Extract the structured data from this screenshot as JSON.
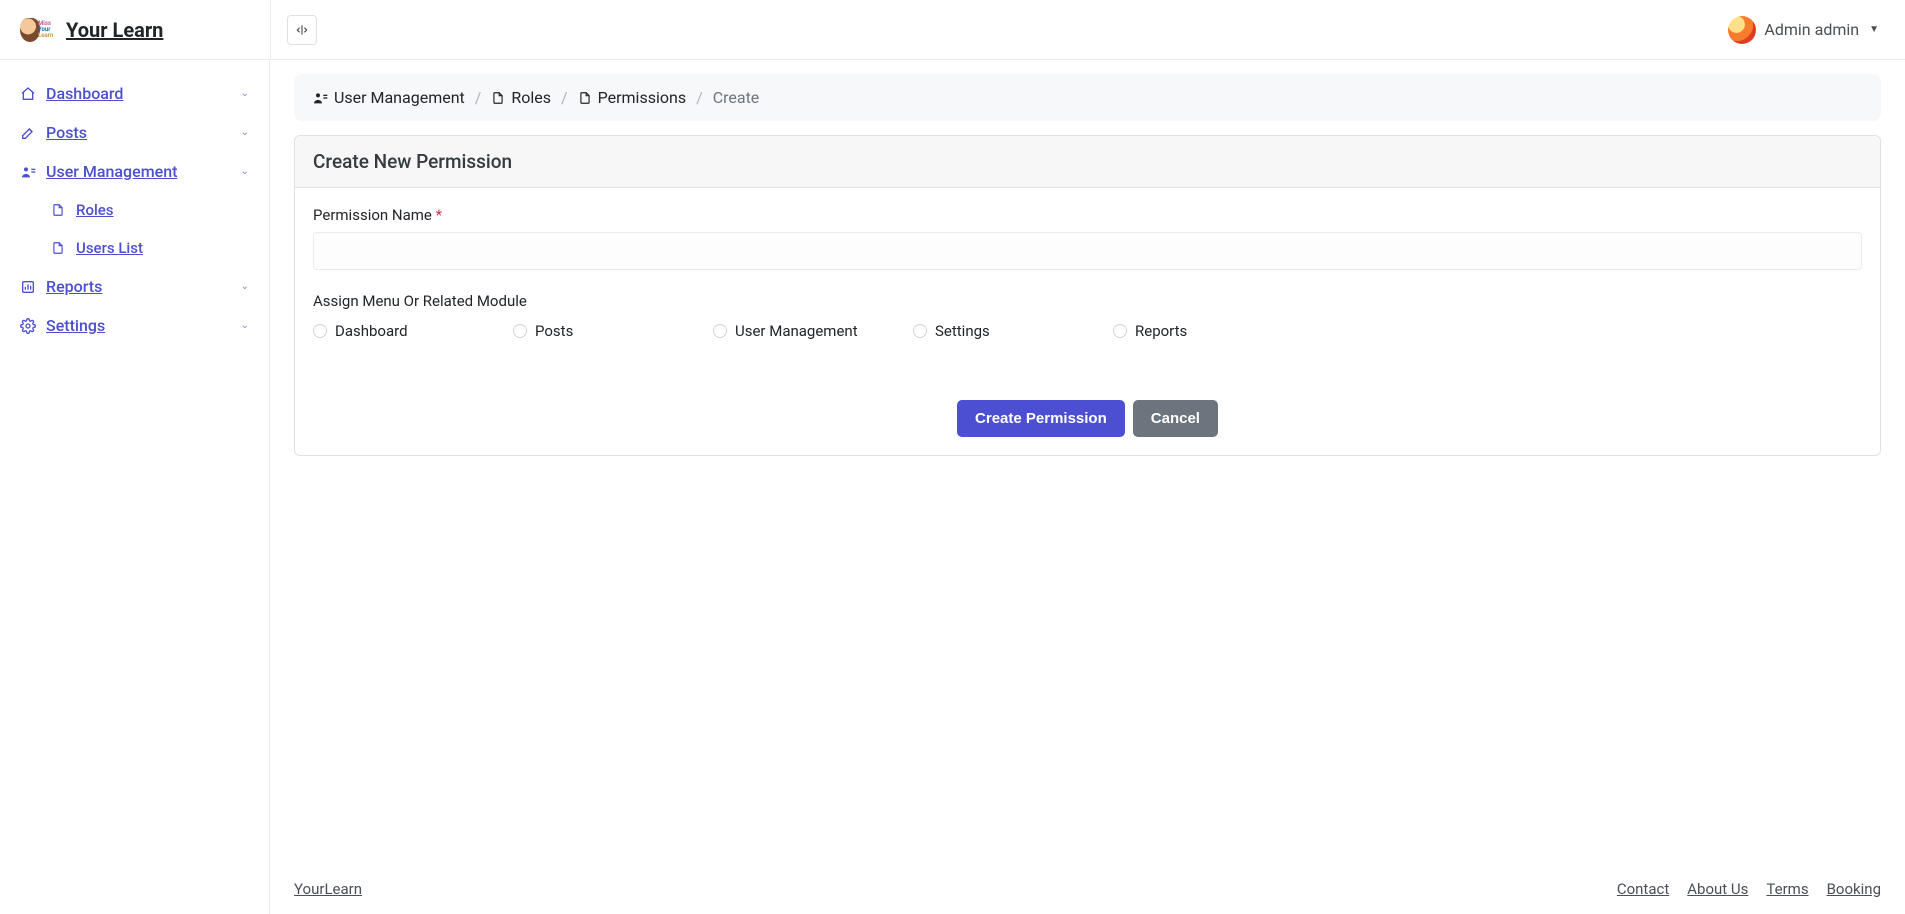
{
  "brand": {
    "name": "Your Learn",
    "footer_name": "YourLearn"
  },
  "user": {
    "display_name": "Admin admin"
  },
  "sidebar": {
    "items": [
      {
        "label": "Dashboard"
      },
      {
        "label": "Posts"
      },
      {
        "label": "User Management",
        "children": [
          {
            "label": "Roles"
          },
          {
            "label": "Users List"
          }
        ]
      },
      {
        "label": "Reports"
      },
      {
        "label": "Settings"
      }
    ]
  },
  "breadcrumb": {
    "items": [
      {
        "label": "User Management"
      },
      {
        "label": "Roles"
      },
      {
        "label": "Permissions"
      },
      {
        "label": "Create"
      }
    ]
  },
  "card": {
    "title": "Create New Permission",
    "permission_name_label": "Permission Name",
    "assign_label": "Assign Menu Or Related Module",
    "modules": [
      {
        "label": "Dashboard"
      },
      {
        "label": "Posts"
      },
      {
        "label": "User Management"
      },
      {
        "label": "Settings"
      },
      {
        "label": "Reports"
      }
    ],
    "submit_label": "Create Permission",
    "cancel_label": "Cancel"
  },
  "footer": {
    "links": [
      {
        "label": "Contact"
      },
      {
        "label": "About Us"
      },
      {
        "label": "Terms"
      },
      {
        "label": "Booking"
      }
    ]
  }
}
